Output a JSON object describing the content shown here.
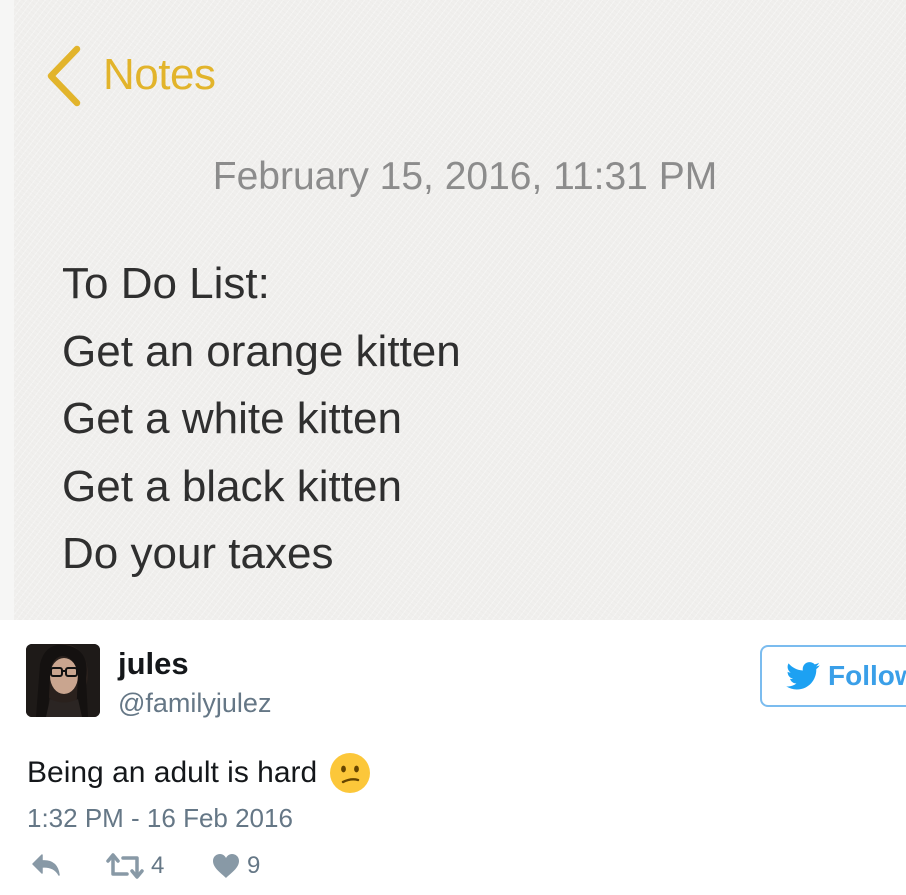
{
  "notes": {
    "back_label": "Notes",
    "accent": "#e2b42b",
    "date": "February 15, 2016, 11:31 PM",
    "lines": [
      "To Do List:",
      "Get an orange kitten",
      "Get a white kitten",
      "Get a black kitten",
      "Do your taxes"
    ]
  },
  "tweet": {
    "display_name": "jules",
    "handle": "@familyjulez",
    "follow_label": "Follow",
    "text": "Being an adult is hard",
    "emoji": "confused-face",
    "timestamp": "1:32 PM - 16 Feb 2016",
    "retweets": "4",
    "likes": "9",
    "brand_color": "#1da1f2"
  }
}
